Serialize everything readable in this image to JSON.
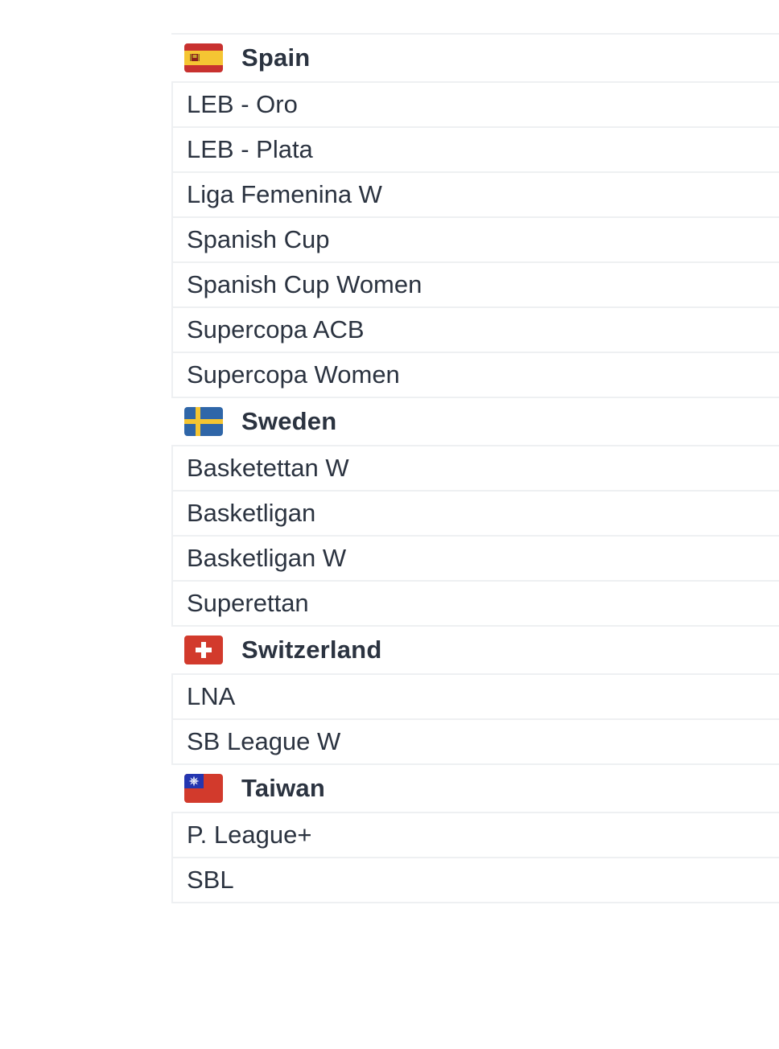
{
  "groups": [
    {
      "country": "Spain",
      "flag_icon": "spain-flag-icon",
      "leagues": [
        "LEB - Oro",
        "LEB - Plata",
        "Liga Femenina W",
        "Spanish Cup",
        "Spanish Cup Women",
        "Supercopa ACB",
        "Supercopa Women"
      ]
    },
    {
      "country": "Sweden",
      "flag_icon": "sweden-flag-icon",
      "leagues": [
        "Basketettan W",
        "Basketligan",
        "Basketligan W",
        "Superettan"
      ]
    },
    {
      "country": "Switzerland",
      "flag_icon": "switzerland-flag-icon",
      "leagues": [
        "LNA",
        "SB League W"
      ]
    },
    {
      "country": "Taiwan",
      "flag_icon": "taiwan-flag-icon",
      "leagues": [
        "P. League+",
        "SBL"
      ]
    }
  ],
  "colors": {
    "text": "#2b3340",
    "divider": "#eef0f2",
    "spain_red": "#c8312f",
    "spain_yellow": "#f5c533",
    "sweden_blue": "#2f66a8",
    "sweden_yellow": "#f5c531",
    "swiss_red": "#d23a2c",
    "taiwan_red": "#d23a2c",
    "taiwan_blue": "#2435b0"
  }
}
